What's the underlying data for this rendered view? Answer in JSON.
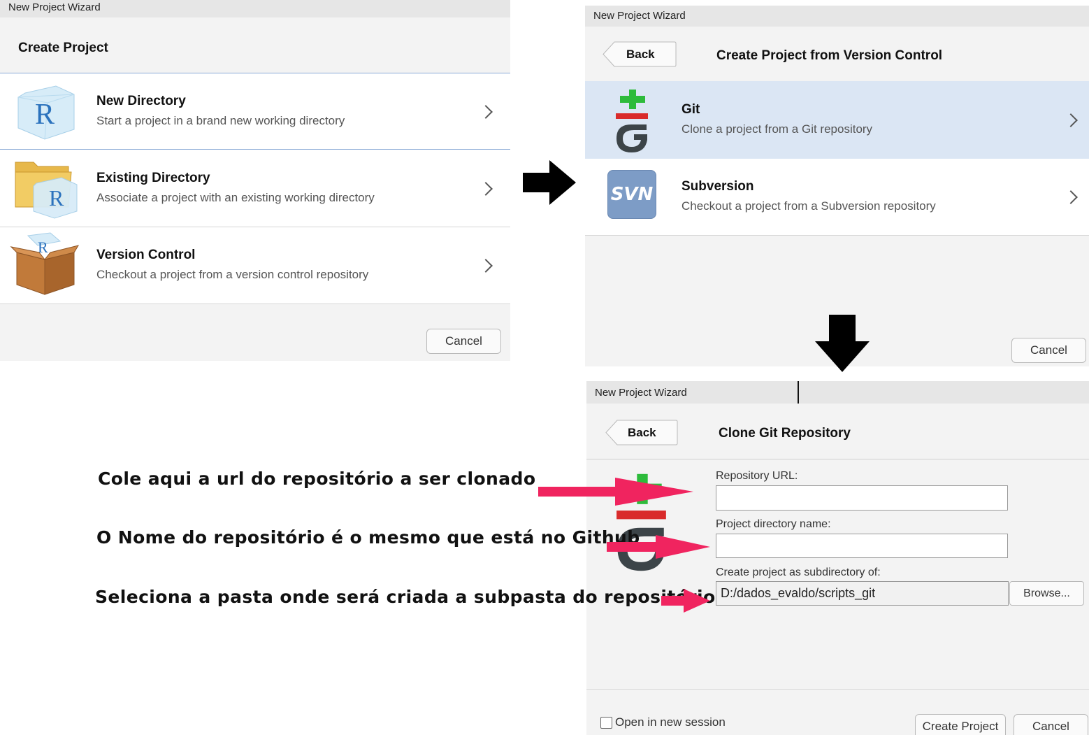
{
  "window_title": "New Project Wizard",
  "panel1": {
    "header": "Create Project",
    "items": [
      {
        "title": "New Directory",
        "desc": "Start a project in a brand new working directory",
        "icon": "r-cube-icon"
      },
      {
        "title": "Existing Directory",
        "desc": "Associate a project with an existing working directory",
        "icon": "folder-r-icon"
      },
      {
        "title": "Version Control",
        "desc": "Checkout a project from a version control repository",
        "icon": "box-icon"
      }
    ],
    "cancel": "Cancel"
  },
  "panel2": {
    "back": "Back",
    "header": "Create Project from Version Control",
    "items": [
      {
        "title": "Git",
        "desc": "Clone a project from a Git repository",
        "icon": "git-icon",
        "selected": true
      },
      {
        "title": "Subversion",
        "desc": "Checkout a project from a Subversion repository",
        "icon": "svn-icon",
        "icon_text": "SVN"
      }
    ],
    "cancel": "Cancel"
  },
  "panel3": {
    "back": "Back",
    "header": "Clone Git Repository",
    "repo_url_label": "Repository URL:",
    "repo_url_value": "",
    "dir_name_label": "Project directory name:",
    "dir_name_value": "",
    "subdir_label": "Create project as subdirectory of:",
    "subdir_value": "D:/dados_evaldo/scripts_git",
    "browse": "Browse...",
    "open_new_session": "Open in new session",
    "open_new_session_checked": false,
    "create_project": "Create Project",
    "cancel": "Cancel"
  },
  "annotations": {
    "url_note": "Cole aqui a url do repositório a ser clonado",
    "name_note": "O Nome do repositório é o mesmo que está no Github",
    "folder_note": "Seleciona a pasta onde será criada a subpasta do repositório"
  },
  "colors": {
    "annotation_arrow": "#f0245f",
    "flow_arrow": "#000000",
    "selected_row": "#dbe6f4",
    "git_green": "#2dbb3b",
    "git_red": "#d92b2b",
    "git_dark": "#3c4448",
    "svn_blue": "#7d9cc6"
  }
}
